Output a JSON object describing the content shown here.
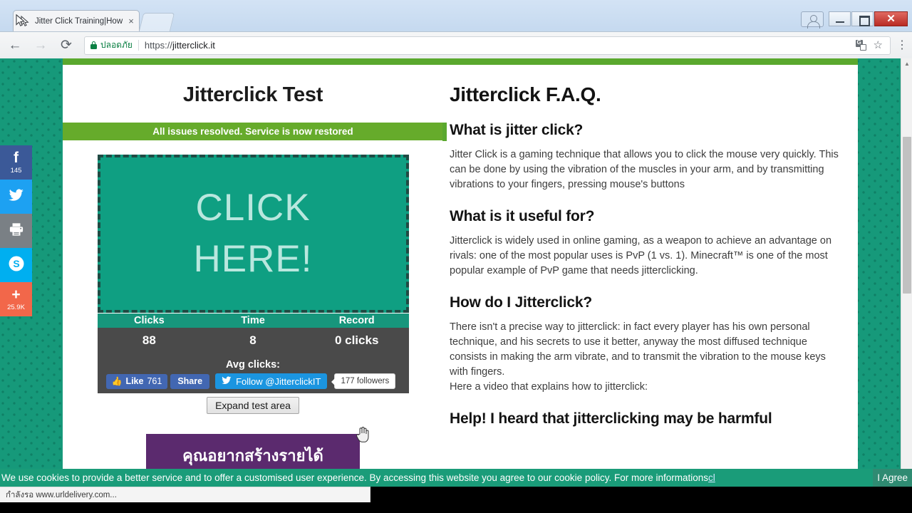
{
  "browser": {
    "tab": {
      "title": "Jitter Click Training|How",
      "close_label": "×",
      "favicon": "cursor-favicon"
    },
    "window": {
      "minimize": "–",
      "maximize": "□",
      "close": "✕",
      "user": "user-avatar-icon"
    },
    "nav": {
      "back": "←",
      "forward": "→",
      "reload": "⟳"
    },
    "omnibox": {
      "secure_label": "ปลอดภัย",
      "url_scheme": "https://",
      "url_host": "jitterclick.it",
      "translate_icon": "translate-icon",
      "star_icon": "☆",
      "menu_icon": "⋮"
    },
    "status_bar": {
      "text": "กำลังรอ www.urldelivery.com..."
    },
    "scrollbar": {
      "up": "▲",
      "down": "▼"
    }
  },
  "social_rail": [
    {
      "name": "facebook",
      "glyph": "f",
      "count": "145",
      "color": "#3b5998"
    },
    {
      "name": "twitter",
      "glyph": "🐦",
      "count": "",
      "color": "#1da1f2"
    },
    {
      "name": "print",
      "glyph": "⎙",
      "count": "",
      "color": "#7a8085"
    },
    {
      "name": "skype",
      "glyph": "S",
      "count": "",
      "color": "#00aff0"
    },
    {
      "name": "share-more",
      "glyph": "+",
      "count": "25.9K",
      "color": "#f2674a"
    }
  ],
  "page": {
    "title": "Jitterclick Test",
    "notice": "All issues resolved. Service is now restored",
    "click_area": {
      "line1": "CLICK",
      "line2": "HERE!"
    },
    "stats": {
      "headers": [
        "Clicks",
        "Time",
        "Record"
      ],
      "values": [
        "88",
        "8",
        "0 clicks"
      ],
      "avg_label": "Avg clicks:"
    },
    "social": {
      "fb_like_label": "Like",
      "fb_like_count": "761",
      "fb_share_label": "Share",
      "twitter_follow_label": "Follow @JitterclickIT",
      "twitter_followers": "177 followers"
    },
    "expand_button": "Expand test area",
    "ad_banner": "คุณอยากสร้างรายได้",
    "faq": {
      "title": "Jitterclick F.A.Q.",
      "items": [
        {
          "question": "What is jitter click?",
          "answer": "Jitter Click is a gaming technique that allows you to click the mouse very quickly. This can be done by using the vibration of the muscles in your arm, and by transmitting vibrations to your fingers, pressing mouse's buttons"
        },
        {
          "question": "What is it useful for?",
          "answer": "Jitterclick is widely used in online gaming, as a weapon to achieve an advantage on rivals: one of the most popular uses is PvP (1 vs. 1). Minecraft™ is one of the most popular example of PvP game that needs jitterclicking."
        },
        {
          "question": "How do I Jitterclick?",
          "answer": "There isn't a precise way to jitterclick: in fact every player has his own personal technique, and his secrets to use it better, anyway the most diffused technique consists in making the arm vibrate, and to transmit the vibration to the mouse keys with fingers.\nHere a video that explains how to jitterclick:"
        },
        {
          "question": "Help! I heard that jitterclicking may be harmful",
          "answer": ""
        }
      ]
    }
  },
  "cookie": {
    "text": "We use cookies to provide a better service and to offer a customised user experience. By accessing this website you agree to our cookie policy. For more informations ",
    "link": "cl",
    "agree_label": "I Agree"
  },
  "colors": {
    "page_bg": "#16997a",
    "accent_green": "#5aa82e",
    "notice_green": "#66ab2b",
    "click_teal": "#0f9f82",
    "stats_head": "#17967c",
    "stats_body": "#4a4a4a",
    "ad_purple": "#5b2a6e",
    "cookie_bar": "#1a9c79"
  }
}
